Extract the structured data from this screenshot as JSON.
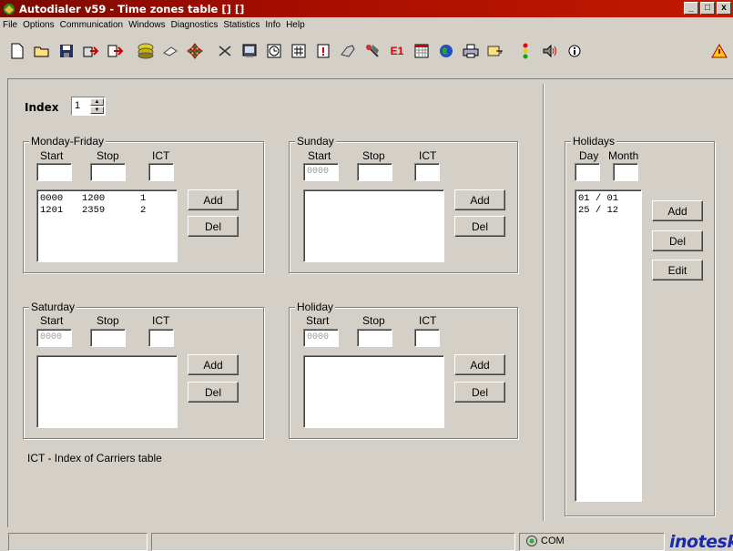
{
  "window": {
    "title": "Autodialer v59 - Time zones table [] []",
    "controls": [
      "_",
      "□",
      "x"
    ]
  },
  "menu": [
    "File",
    "Options",
    "Communication",
    "Windows",
    "Diagnostics",
    "Statistics",
    "Info",
    "Help"
  ],
  "toolbar": {
    "icons": [
      "new-file-icon",
      "open-folder-icon",
      "save-disk-icon",
      "import-icon",
      "export-icon",
      "database-icon",
      "eraser-icon",
      "move-icon",
      "cut-icon",
      "terminal-icon",
      "clock-icon",
      "grid-icon",
      "alert-file-icon",
      "settings-icon",
      "wizard-icon",
      "e1-icon",
      "calendar-icon",
      "globe-icon",
      "printer-icon",
      "key-icon",
      "traffic-light-icon",
      "speaker-icon",
      "info-icon",
      "warning-icon"
    ],
    "e1_label": "E1"
  },
  "index": {
    "label": "Index",
    "value": "1"
  },
  "groups": {
    "monday_friday": {
      "title": "Monday-Friday",
      "col_start": "Start",
      "col_stop": "Stop",
      "col_ict": "ICT",
      "start_value": "",
      "stop_value": "",
      "ict_value": "",
      "rows": [
        {
          "start": "0000",
          "stop": "1200",
          "ict": "1"
        },
        {
          "start": "1201",
          "stop": "2359",
          "ict": "2"
        }
      ],
      "add_label": "Add",
      "del_label": "Del"
    },
    "sunday": {
      "title": "Sunday",
      "col_start": "Start",
      "col_stop": "Stop",
      "col_ict": "ICT",
      "start_value": "0000",
      "stop_value": "",
      "ict_value": "",
      "add_label": "Add",
      "del_label": "Del"
    },
    "saturday": {
      "title": "Saturday",
      "col_start": "Start",
      "col_stop": "Stop",
      "col_ict": "ICT",
      "start_value": "0000",
      "stop_value": "",
      "ict_value": "",
      "add_label": "Add",
      "del_label": "Del"
    },
    "holiday": {
      "title": "Holiday",
      "col_start": "Start",
      "col_stop": "Stop",
      "col_ict": "ICT",
      "start_value": "0000",
      "stop_value": "",
      "ict_value": "",
      "add_label": "Add",
      "del_label": "Del"
    },
    "holidays": {
      "title": "Holidays",
      "col_day": "Day",
      "col_month": "Month",
      "day_value": "",
      "month_value": "",
      "rows": [
        "01 / 01",
        "25 / 12"
      ],
      "add_label": "Add",
      "del_label": "Del",
      "edit_label": "Edit"
    }
  },
  "note": "ICT - Index of Carriers table",
  "status": {
    "com_label": "COM",
    "logo": "inoteska"
  },
  "colors": {
    "title_bar": "#a20c00",
    "face": "#d4d0c8",
    "logo": "#1a2aa8"
  }
}
